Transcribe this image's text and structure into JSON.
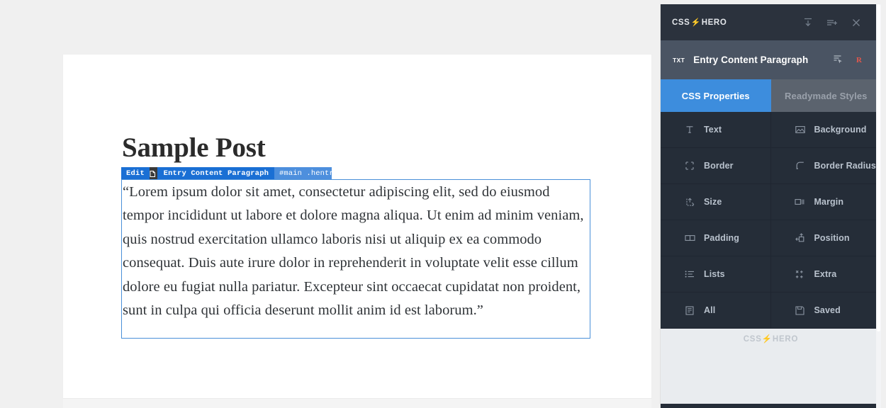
{
  "website": {
    "post_title": "Sample Post",
    "paragraph": "“Lorem ipsum dolor sit amet, consectetur adipiscing elit, sed do eiusmod tempor incididunt ut labore et dolore magna aliqua. Ut enim ad minim veniam, quis nostrud exercitation ullamco laboris nisi ut aliquip ex ea commodo consequat. Duis aute irure dolor in reprehenderit in voluptate velit esse cillum dolore eu fugiat nulla pariatur. Excepteur sint occaecat cupidatat non proident, sunt in culpa qui officia deserunt mollit anim id est laborum.”"
  },
  "inline_toolbar": {
    "edit_label": "Edit",
    "copy_icon": "copy-icon",
    "element_label": "Entry Content Paragraph",
    "selector": "#main .hentry .entr",
    "edit_bg": "#1a6fd4",
    "selector_bg": "#4d8fdd"
  },
  "panel": {
    "logo": {
      "prefix": "CSS",
      "bolt": "⚡",
      "suffix": "HERO"
    },
    "titlebar_icons": [
      {
        "name": "collapse-icon",
        "glyph": "collapse"
      },
      {
        "name": "add-rule-icon",
        "glyph": "list-plus"
      },
      {
        "name": "close-icon",
        "glyph": "close"
      }
    ],
    "element_bar": {
      "badge": "TXT",
      "name": "Entry Content Paragraph",
      "icons": [
        {
          "name": "select-element-icon",
          "glyph": "cursor-select"
        },
        {
          "name": "reset-icon",
          "glyph": "R",
          "color": "#e2574c"
        }
      ]
    },
    "tabs": [
      {
        "label": "CSS Properties",
        "active": true,
        "color": "#3d8ddd"
      },
      {
        "label": "Readymade Styles",
        "active": false,
        "color": "#5b636e"
      }
    ],
    "properties": [
      {
        "label": "Text",
        "icon": "text-icon"
      },
      {
        "label": "Background",
        "icon": "background-icon"
      },
      {
        "label": "Border",
        "icon": "border-icon"
      },
      {
        "label": "Border Radius",
        "icon": "border-radius-icon"
      },
      {
        "label": "Size",
        "icon": "size-icon"
      },
      {
        "label": "Margin",
        "icon": "margin-icon"
      },
      {
        "label": "Padding",
        "icon": "padding-icon"
      },
      {
        "label": "Position",
        "icon": "position-icon"
      },
      {
        "label": "Lists",
        "icon": "lists-icon"
      },
      {
        "label": "Extra",
        "icon": "extra-icon"
      },
      {
        "label": "All",
        "icon": "all-icon"
      },
      {
        "label": "Saved",
        "icon": "saved-icon"
      }
    ],
    "footer": {
      "logo_prefix": "CSS",
      "logo_bolt": "⚡",
      "logo_suffix": "HERO"
    },
    "colors": {
      "panel_bg": "#252d38",
      "titlebar_bg": "#2b323d",
      "element_bar_bg": "#4a5463",
      "accent": "#3d8ddd",
      "footer_bg": "#e9ecef"
    }
  }
}
